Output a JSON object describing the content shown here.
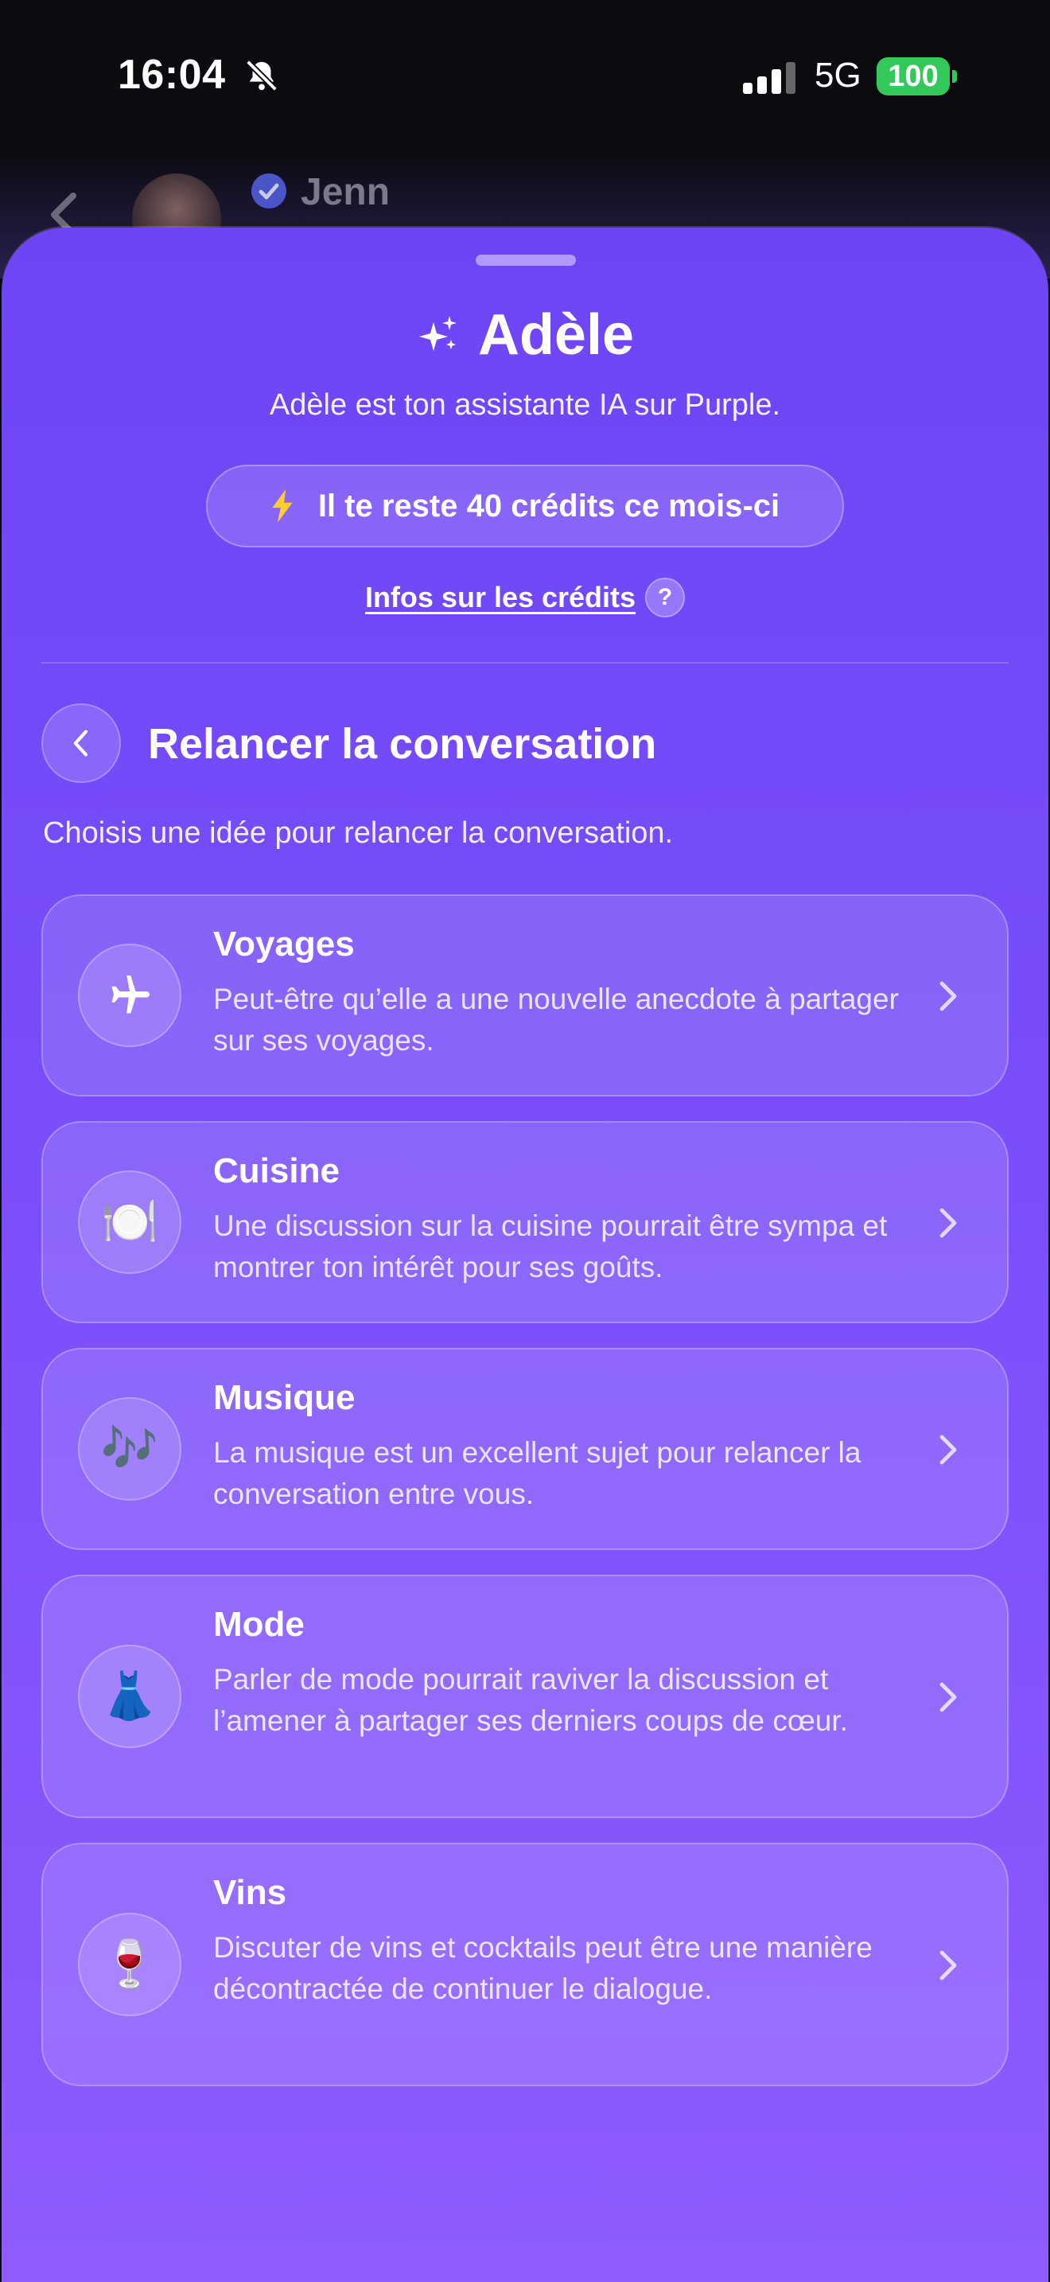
{
  "status_bar": {
    "time": "16:04",
    "network": "5G",
    "battery": "100"
  },
  "background_chat": {
    "contact_name": "Jenn"
  },
  "sheet": {
    "title": "Adèle",
    "subtitle": "Adèle est ton assistante IA sur Purple.",
    "credits_label": "Il te reste 40 crédits ce mois-ci",
    "info_link": "Infos sur les crédits",
    "help_symbol": "?",
    "section_title": "Relancer la conversation",
    "section_description": "Choisis une idée pour relancer la conversation.",
    "topics": [
      {
        "title": "Voyages",
        "description": "Peut-être qu’elle a une nouvelle anecdote à partager sur ses voyages.",
        "icon": "airplane-icon"
      },
      {
        "title": "Cuisine",
        "description": "Une discussion sur la cuisine pourrait être sympa et montrer ton intérêt pour ses goûts.",
        "icon": "plate-icon",
        "emoji": "🍽️"
      },
      {
        "title": "Musique",
        "description": "La musique est un excellent sujet pour relancer la conversation entre vous.",
        "icon": "music-notes-icon",
        "emoji": "🎶"
      },
      {
        "title": "Mode",
        "description": "Parler de mode pourrait raviver la discussion et l’amener à partager ses derniers coups de cœur.",
        "icon": "dress-icon",
        "emoji": "👗"
      },
      {
        "title": "Vins",
        "description": "Discuter de vins et cocktails peut être une manière décontractée de continuer le dialogue.",
        "icon": "wine-glass-icon",
        "emoji": "🍷"
      }
    ]
  },
  "colors": {
    "sheet_top": "#6e45f5",
    "sheet_bottom": "#8e5cff",
    "battery": "#34c759",
    "bolt": "#ffcc33"
  }
}
